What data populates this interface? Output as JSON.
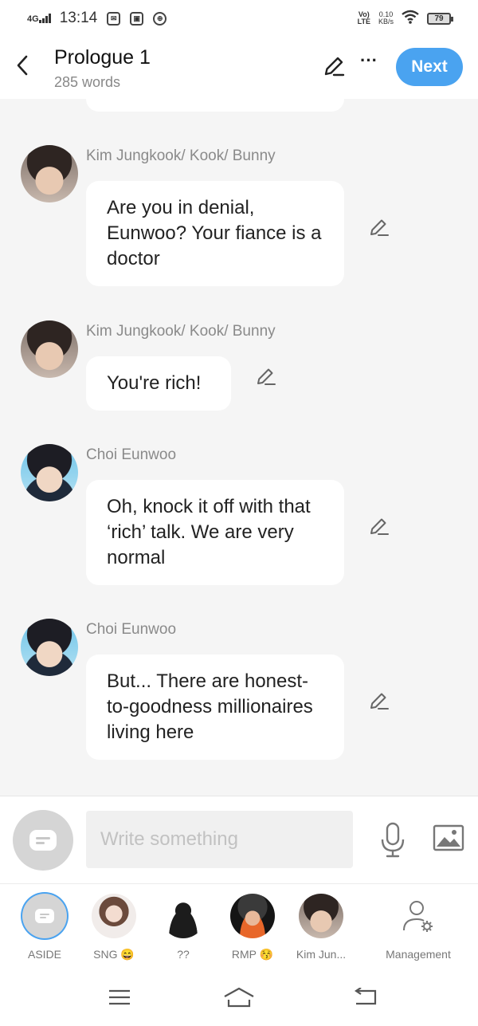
{
  "status_bar": {
    "network": "4G",
    "time": "13:14",
    "volte": "Vo)\nLTE",
    "speed_value": "0.10",
    "speed_unit": "KB/s",
    "battery": "79"
  },
  "header": {
    "title": "Prologue 1",
    "word_count": "285 words",
    "more_label": "···",
    "next_label": "Next"
  },
  "messages": [
    {
      "sender": "Kim Jungkook/ Kook/ Bunny",
      "text": "Are you in denial, Eunwoo? Your fiance is a doctor",
      "avatar": "kim-jungkook"
    },
    {
      "sender": "Kim Jungkook/ Kook/ Bunny",
      "text": "You're rich!",
      "avatar": "kim-jungkook"
    },
    {
      "sender": "Choi Eunwoo",
      "text": "Oh, knock it off with that ‘rich’ talk. We are very normal",
      "avatar": "choi-eunwoo"
    },
    {
      "sender": "Choi Eunwoo",
      "text": "But... There are honest-to-goodness millionaires living here",
      "avatar": "choi-eunwoo"
    }
  ],
  "composer": {
    "placeholder": "Write something"
  },
  "characters": [
    {
      "label": "ASIDE"
    },
    {
      "label": "SNG 😄"
    },
    {
      "label": "??"
    },
    {
      "label": "RMP 😚"
    },
    {
      "label": "Kim Jun..."
    },
    {
      "label": "Management"
    }
  ],
  "colors": {
    "accent": "#4aa3f0",
    "background": "#f5f5f5",
    "bubble": "#ffffff",
    "sender_text": "#8a8a8a"
  }
}
